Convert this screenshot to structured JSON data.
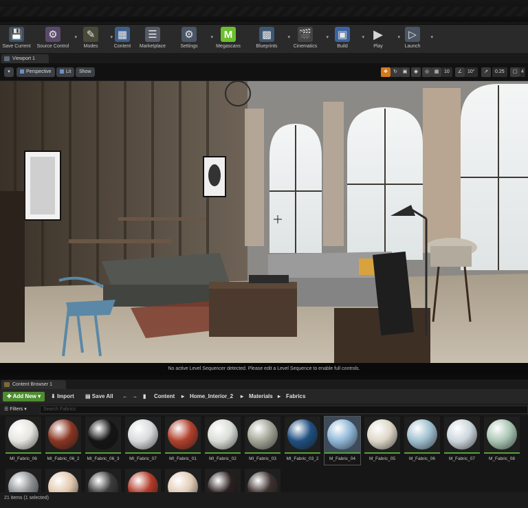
{
  "toolbar": {
    "items": [
      {
        "label": "Save Current",
        "icon": "save-icon"
      },
      {
        "label": "Source Control",
        "icon": "source-control-icon"
      },
      {
        "label": "Modes",
        "icon": "modes-icon"
      },
      {
        "label": "Content",
        "icon": "content-icon"
      },
      {
        "label": "Marketplace",
        "icon": "marketplace-icon"
      },
      {
        "label": "Settings",
        "icon": "settings-icon"
      },
      {
        "label": "Megascans",
        "icon": "megascans-icon"
      },
      {
        "label": "Blueprints",
        "icon": "blueprints-icon"
      },
      {
        "label": "Cinematics",
        "icon": "cinematics-icon"
      },
      {
        "label": "Build",
        "icon": "build-icon"
      },
      {
        "label": "Play",
        "icon": "play-icon"
      },
      {
        "label": "Launch",
        "icon": "launch-icon"
      }
    ]
  },
  "viewport": {
    "tab_label": "Viewport 1",
    "perspective": "Perspective",
    "lit": "Lit",
    "show": "Show",
    "grid_snap": "10",
    "rotation_snap": "10°",
    "scale_snap": "0.25",
    "camera_speed": "4",
    "status_message": "No active Level Sequencer detected. Please edit a Level Sequence to enable full controls."
  },
  "content_browser": {
    "tab_label": "Content Browser 1",
    "add_new": "Add New",
    "import": "Import",
    "save_all": "Save All",
    "breadcrumb": [
      "Content",
      "Home_Interior_2",
      "Materials",
      "Fabrics"
    ],
    "filters": "Filters",
    "search_placeholder": "Search Fabrics",
    "assets": [
      {
        "name": "MI_Fabric_06",
        "color": "#e6e4df"
      },
      {
        "name": "MI_Fabric_06_2",
        "color": "#8a3522"
      },
      {
        "name": "MI_Fabric_06_3",
        "color": "#141414"
      },
      {
        "name": "MI_Fabric_07",
        "color": "#d8dadc"
      },
      {
        "name": "MI_Fabric_01",
        "color": "#b0402c"
      },
      {
        "name": "MI_Fabric_02",
        "color": "#d9ddd6"
      },
      {
        "name": "MI_Fabric_03",
        "color": "#a3a497"
      },
      {
        "name": "MI_Fabric_03_2",
        "color": "#1f4f80"
      },
      {
        "name": "M_Fabric_04",
        "color": "#8fb6d7"
      },
      {
        "name": "M_Fabric_05",
        "color": "#ded7c8"
      },
      {
        "name": "M_Fabric_06",
        "color": "#9fbfcf"
      },
      {
        "name": "M_Fabric_07",
        "color": "#cbd6dc"
      },
      {
        "name": "M_Fabric_08",
        "color": "#a9c6b4"
      }
    ],
    "second_row_colors": [
      "#8c8f92",
      "#e1c7ad",
      "#3a3a3a",
      "#b13a28",
      "#e1cbb7",
      "#2a1f1f",
      "#3b302e"
    ],
    "selected_asset": "M_Fabric_04",
    "item_count": "21 items (1 selected)"
  }
}
